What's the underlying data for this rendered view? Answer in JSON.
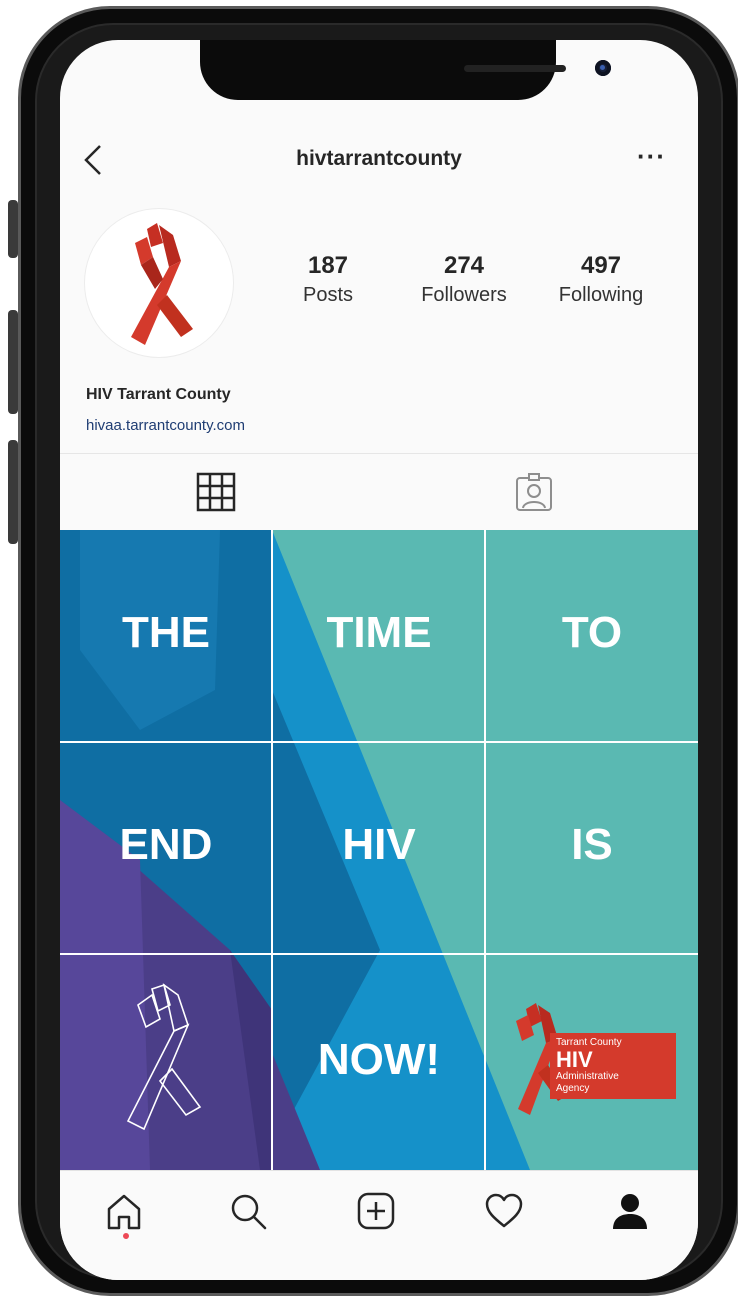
{
  "header": {
    "back_glyph": "‹",
    "username": "hivtarrantcounty",
    "more_glyph": "···"
  },
  "profile": {
    "stats": [
      {
        "value": "187",
        "label": "Posts"
      },
      {
        "value": "274",
        "label": "Followers"
      },
      {
        "value": "497",
        "label": "Following"
      }
    ],
    "display_name": "HIV Tarrant County",
    "website": "hivaa.tarrantcounty.com"
  },
  "tabs": [
    {
      "icon": "grid-icon",
      "active": true
    },
    {
      "icon": "tagged-photos-icon",
      "active": false
    }
  ],
  "grid_words": [
    "THE",
    "TIME",
    "TO",
    "END",
    "HIV",
    "IS",
    "NOW!"
  ],
  "logo_tile": {
    "line1": "Tarrant County",
    "line2": "HIV",
    "line3": "Administrative",
    "line4": "Agency"
  },
  "bottom_nav": [
    {
      "icon": "home-icon",
      "active": true
    },
    {
      "icon": "search-icon",
      "active": false
    },
    {
      "icon": "new-post-icon",
      "active": false
    },
    {
      "icon": "activity-heart-icon",
      "active": false
    },
    {
      "icon": "profile-icon",
      "active": false
    }
  ],
  "colors": {
    "dark_blue": "#0f6ea3",
    "mid_blue": "#1591c9",
    "teal": "#5ab9b2",
    "purple": "#4b3e88",
    "ribbon_red": "#d43a2c"
  }
}
